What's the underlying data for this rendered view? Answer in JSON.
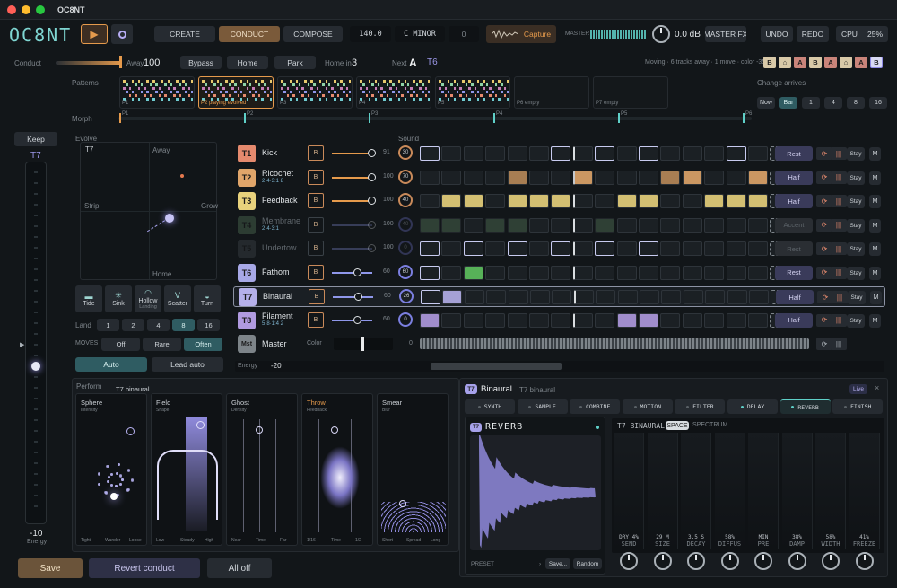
{
  "app": {
    "title": "OC8NT",
    "logo": "OC8NT"
  },
  "top": {
    "create": "CREATE",
    "conduct": "CONDUCT",
    "compose": "COMPOSE",
    "tempo": "140.0",
    "key": "C MINOR",
    "transpose": "0",
    "capture": "Capture",
    "master_label": "MASTER",
    "master_db": "0.0 dB",
    "master_fx": "MASTER FX",
    "undo": "UNDO",
    "redo": "REDO",
    "cpu_label": "CPU",
    "cpu_value": "25%"
  },
  "conduct_row": {
    "label": "Conduct",
    "away_label": "Away",
    "away_value": "100",
    "bypass": "Bypass",
    "home": "Home",
    "park": "Park",
    "home_in_label": "Home in",
    "home_in_value": "3",
    "next_label": "Next",
    "next_value": "A",
    "next_track": "T6",
    "status": "Moving · 6 tracks away · 1 move · color -35",
    "chips": [
      "B",
      "⌂",
      "A",
      "B",
      "A",
      "⌂",
      "A",
      "B"
    ]
  },
  "patterns": {
    "label": "Patterns",
    "items": [
      {
        "num": "P1",
        "sub": ""
      },
      {
        "num": "P2",
        "sub": "P2 playing evolved"
      },
      {
        "num": "P3",
        "sub": ""
      },
      {
        "num": "P4",
        "sub": ""
      },
      {
        "num": "P5",
        "sub": ""
      },
      {
        "num": "P6",
        "sub": "P6 empty"
      },
      {
        "num": "P7",
        "sub": "P7 empty"
      }
    ],
    "change_label": "Change arrives",
    "change_opts": [
      "Now",
      "Bar",
      "1",
      "4",
      "8",
      "16"
    ]
  },
  "morph": {
    "label": "Morph",
    "marks": [
      "P1",
      "P2",
      "P3",
      "P4",
      "P5",
      "P6"
    ]
  },
  "left": {
    "keep": "Keep",
    "track": "T7",
    "low": "-10",
    "energy": "Energy"
  },
  "evolve": {
    "label": "Evolve",
    "track": "T7",
    "top": "Away",
    "bottom": "Home",
    "left": "Strip",
    "right": "Grow",
    "tools": [
      "Tide",
      "Sink",
      "Hollow",
      "Scatter",
      "Turn"
    ],
    "hollow_sub": "Landing",
    "land_label": "Land",
    "land_opts": [
      "1",
      "2",
      "4",
      "8",
      "16"
    ],
    "moves_label": "MOVES",
    "moves_opts": [
      "Off",
      "Rare",
      "Often"
    ],
    "auto": "Auto",
    "lead_auto": "Lead auto"
  },
  "tracks": {
    "sound_label": "Sound",
    "rows": [
      {
        "id": "T1",
        "name": "Kick",
        "vol": "91",
        "sound": "30",
        "action": "Rest",
        "sub": "",
        "color": "#e58a6e"
      },
      {
        "id": "T2",
        "name": "Ricochet",
        "vol": "100",
        "sound": "70",
        "action": "Half",
        "sub": "2·4·3:1  8",
        "color": "#e0a56a"
      },
      {
        "id": "T3",
        "name": "Feedback",
        "vol": "100",
        "sound": "40",
        "action": "Half",
        "sub": "",
        "color": "#e8d27c"
      },
      {
        "id": "T4",
        "name": "Membrane",
        "vol": "100",
        "sound": "40",
        "action": "Accent",
        "sub": "2·4·3:1",
        "color": "#4c6b52"
      },
      {
        "id": "T5",
        "name": "Undertow",
        "vol": "100",
        "sound": "0",
        "action": "Rest",
        "sub": "",
        "color": "#3a4147"
      },
      {
        "id": "T6",
        "name": "Fathom",
        "vol": "60",
        "sound": "60",
        "action": "Rest",
        "sub": "",
        "color": "#a7a8e6"
      },
      {
        "id": "T7",
        "name": "Binaural",
        "vol": "60",
        "sound": "26",
        "action": "Half",
        "sub": "",
        "color": "#b5b0ea"
      },
      {
        "id": "T8",
        "name": "Filament",
        "vol": "60",
        "sound": "0",
        "action": "Half",
        "sub": "5·8·1:4  2",
        "color": "#b09ae0"
      }
    ],
    "stay": "Stay",
    "m": "M",
    "master_id": "Mst",
    "master_name": "Master",
    "color_label": "Color",
    "master_vol": "0",
    "energy_label": "Energy",
    "energy_value": "-20"
  },
  "perform": {
    "label": "Perform",
    "track": "T7 binaural",
    "pads": [
      {
        "name": "Sphere",
        "sub": "Intensity",
        "feet": [
          "Tight",
          "Wander",
          "Loose"
        ]
      },
      {
        "name": "Field",
        "sub": "Shape",
        "feet": [
          "Low",
          "Steady",
          "High"
        ]
      },
      {
        "name": "Ghost",
        "sub": "Density",
        "feet": [
          "Near",
          "Time",
          "Far"
        ]
      },
      {
        "name": "Throw",
        "sub": "Feedback",
        "feet": [
          "1/16",
          "Time",
          "1/2"
        ]
      },
      {
        "name": "Smear",
        "sub": "Blur",
        "feet": [
          "Short",
          "Spread",
          "Long"
        ]
      }
    ]
  },
  "editor": {
    "track": "T7",
    "name": "Binaural",
    "sub": "T7 binaural",
    "live": "Live",
    "tabs": [
      "SYNTH",
      "SAMPLE",
      "COMBINE",
      "MOTION",
      "FILTER",
      "DELAY",
      "REVERB",
      "FINISH"
    ],
    "module_id": "T7",
    "module": "REVERB",
    "preset": "PRESET",
    "save_dots": "Save...",
    "random": "Random",
    "header": "T7 BINAURAL",
    "space": "SPACE",
    "spectrum": "SPECTRUM",
    "params": [
      {
        "v": "DRY 4%",
        "n": "SEND"
      },
      {
        "v": "29 M",
        "n": "SIZE"
      },
      {
        "v": "3.5 S",
        "n": "DECAY"
      },
      {
        "v": "58%",
        "n": "DIFFUS"
      },
      {
        "v": "MIN",
        "n": "PRE"
      },
      {
        "v": "38%",
        "n": "DAMP"
      },
      {
        "v": "58%",
        "n": "WIDTH"
      },
      {
        "v": "41%",
        "n": "FREEZE"
      }
    ]
  },
  "footer": {
    "save": "Save",
    "revert": "Revert conduct",
    "all_off": "All off"
  },
  "colors": {
    "accent": "#e59a4c",
    "teal": "#5fd0c8",
    "purple": "#a99ff0"
  }
}
